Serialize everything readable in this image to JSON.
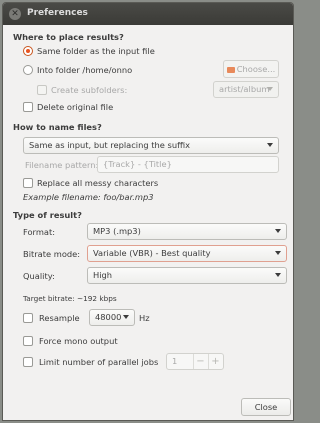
{
  "window": {
    "title": "Preferences"
  },
  "placement": {
    "heading": "Where to place results?",
    "same_folder_label": "Same folder as the input file",
    "into_folder_label": "Into folder /home/onno",
    "choose_button": "Choose...",
    "create_subfolders_label": "Create subfolders:",
    "subfolder_pattern": "artist/album",
    "delete_original_label": "Delete original file"
  },
  "naming": {
    "heading": "How to name files?",
    "scheme": "Same as input, but replacing the suffix",
    "pattern_label": "Filename pattern:",
    "pattern_value": "{Track} - {Title}",
    "replace_messy_label": "Replace all messy characters",
    "example": "Example filename: foo/bar.mp3"
  },
  "result_type": {
    "heading": "Type of result?",
    "format_label": "Format:",
    "format_value": "MP3 (.mp3)",
    "bitrate_mode_label": "Bitrate mode:",
    "bitrate_mode_value": "Variable (VBR) - Best quality",
    "quality_label": "Quality:",
    "quality_value": "High",
    "target_bitrate": "Target bitrate: ~192 kbps",
    "resample_label": "Resample",
    "resample_value": "48000",
    "resample_unit": "Hz",
    "force_mono_label": "Force mono output",
    "limit_jobs_label": "Limit number of parallel jobs",
    "jobs_value": "1"
  },
  "footer": {
    "close_button": "Close"
  },
  "colors": {
    "accent": "#e95420",
    "titlebar": "#3c3b37",
    "background": "#f2f1f0"
  }
}
